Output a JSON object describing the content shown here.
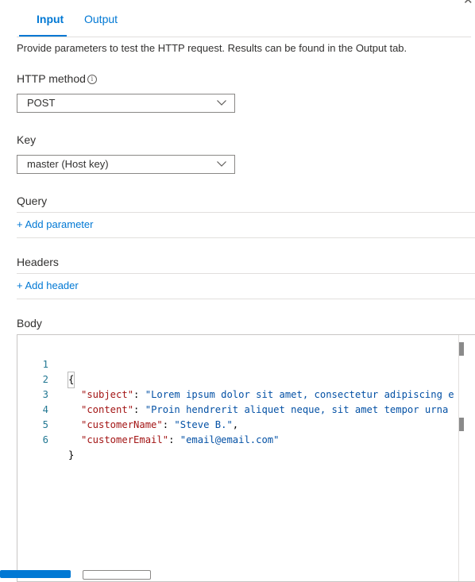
{
  "tabs": [
    {
      "label": "Input",
      "active": true
    },
    {
      "label": "Output",
      "active": false
    }
  ],
  "description": "Provide parameters to test the HTTP request. Results can be found in the Output tab.",
  "http_method": {
    "label": "HTTP method",
    "value": "POST"
  },
  "key": {
    "label": "Key",
    "value": "master (Host key)"
  },
  "query": {
    "label": "Query",
    "add_label": "+ Add parameter"
  },
  "headers": {
    "label": "Headers",
    "add_label": "+ Add header"
  },
  "body": {
    "label": "Body",
    "line_numbers": [
      "1",
      "2",
      "3",
      "4",
      "5",
      "6"
    ],
    "lines": {
      "l1": "{",
      "l2_key": "\"subject\"",
      "l2_val": "\"Lorem ipsum dolor sit amet, consectetur adipiscing e",
      "l3_key": "\"content\"",
      "l3_val": "\"Proin hendrerit aliquet neque, sit amet tempor urna",
      "l4_key": "\"customerName\"",
      "l4_val": "\"Steve B.\"",
      "l5_key": "\"customerEmail\"",
      "l5_val": "\"email@email.com\"",
      "l6": "}"
    }
  },
  "colors": {
    "accent": "#0078d4",
    "json_key": "#a31515",
    "json_string": "#0451a5",
    "line_number": "#237893"
  }
}
